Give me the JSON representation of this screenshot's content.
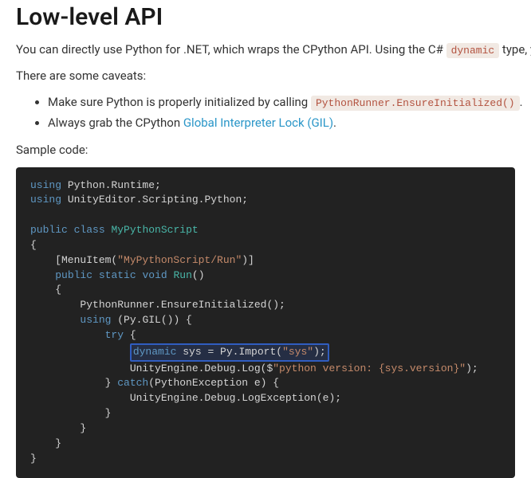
{
  "heading": "Low-level API",
  "intro_prefix": "You can directly use Python for .NET, which wraps the CPython API. Using the C# ",
  "intro_code": "dynamic",
  "intro_suffix": " type, you can",
  "caveats_intro": "There are some caveats:",
  "caveat1_prefix": "Make sure Python is properly initialized by calling ",
  "caveat1_code": "PythonRunner.EnsureInitialized()",
  "caveat1_suffix": ".",
  "caveat2_prefix": "Always grab the CPython ",
  "caveat2_link": "Global Interpreter Lock (GIL)",
  "caveat2_suffix": ".",
  "sample_label": "Sample code:",
  "code": {
    "using_kw": "using",
    "ns1": " Python.Runtime;",
    "ns2": " UnityEditor.Scripting.Python;",
    "public_kw": "public",
    "class_kw": "class",
    "cls_name": "MyPythonScript",
    "open_brace": "{",
    "menuitem_prefix": "    [MenuItem(",
    "menuitem_str": "\"MyPythonScript/Run\"",
    "menuitem_suffix": ")]",
    "static_kw": "static",
    "void_kw": "void",
    "run_name": "Run",
    "run_parens": "()",
    "brace2": "    {",
    "ensure": "        PythonRunner.EnsureInitialized();",
    "using_inner": "        ",
    "gil_open": " (Py.GIL()) {",
    "try_indent": "            ",
    "try_kw": "try",
    "try_open": " {",
    "dyn_indent": "                ",
    "dynamic_kw": "dynamic",
    "sys_assign": " sys = Py.Import(",
    "sys_str": "\"sys\"",
    "sys_close": ");",
    "log_indent": "                UnityEngine.Debug.Log($",
    "log_str": "\"python version: {sys.version}\"",
    "log_close": ");",
    "catch_indent": "            } ",
    "catch_kw": "catch",
    "catch_tail": "(PythonException e) {",
    "logex": "                UnityEngine.Debug.LogException(e);",
    "close1": "            }",
    "close2": "        }",
    "close3": "    }",
    "close4": "}"
  }
}
